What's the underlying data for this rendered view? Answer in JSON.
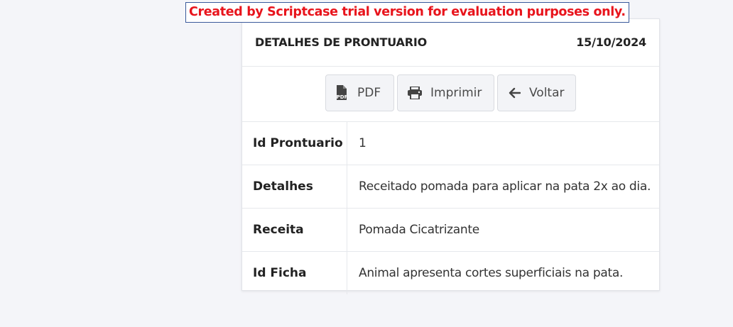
{
  "trial_banner": "Created by Scriptcase trial version for evaluation purposes only.",
  "header": {
    "title": "DETALHES DE PRONTUARIO",
    "date": "15/10/2024"
  },
  "toolbar": {
    "pdf_label": "PDF",
    "print_label": "Imprimir",
    "back_label": "Voltar",
    "icons": [
      "file-pdf-icon",
      "printer-icon",
      "arrow-left-icon"
    ]
  },
  "details": [
    {
      "label": "Id Prontuario",
      "value": "1"
    },
    {
      "label": "Detalhes",
      "value": "Receitado pomada para aplicar na pata 2x ao dia."
    },
    {
      "label": "Receita",
      "value": "Pomada Cicatrizante"
    },
    {
      "label": "Id Ficha",
      "value": "Animal apresenta cortes superficiais na pata."
    }
  ],
  "colors": {
    "page_background": "#f4f5f9",
    "banner_text": "#e8141c",
    "banner_border": "#3a5a9b",
    "button_background": "#f3f4f7"
  }
}
